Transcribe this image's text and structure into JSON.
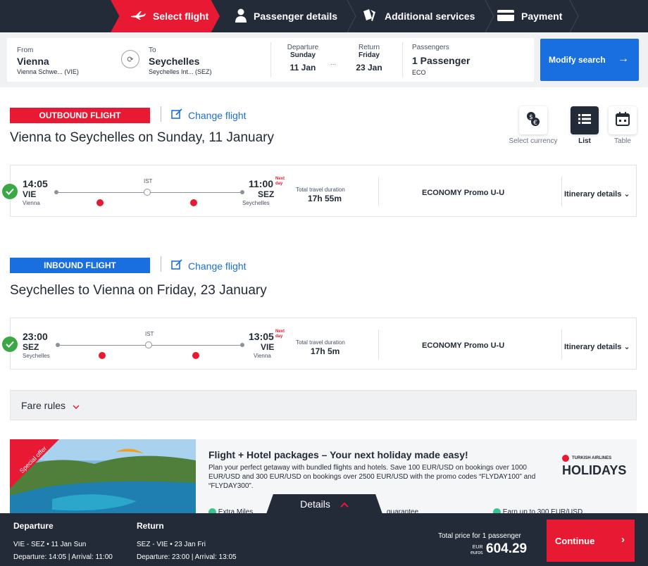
{
  "steps": [
    {
      "label": "Select flight",
      "icon": "plane-icon",
      "active": true
    },
    {
      "label": "Passenger details",
      "icon": "person-icon",
      "active": false
    },
    {
      "label": "Additional services",
      "icon": "services-icon",
      "active": false
    },
    {
      "label": "Payment",
      "icon": "card-icon",
      "active": false
    }
  ],
  "search": {
    "from_label": "From",
    "from_city": "Vienna",
    "from_airport": "Vienna Schwe... (VIE)",
    "to_label": "To",
    "to_city": "Seychelles",
    "to_airport": "Seychelles Int... (SEZ)",
    "departure_label": "Departure",
    "departure_day": "Sunday",
    "departure_date": "11 Jan",
    "range_dots": "...",
    "return_label": "Return",
    "return_day": "Friday",
    "return_date": "23 Jan",
    "passengers_label": "Passengers",
    "passengers_value": "1 Passenger",
    "cabin": "ECO",
    "modify_label": "Modify search"
  },
  "view": {
    "currency_label": "Select currency",
    "list_label": "List",
    "table_label": "Table"
  },
  "outbound": {
    "badge": "OUTBOUND FLIGHT",
    "change": "Change flight",
    "title": "Vienna to Seychelles on Sunday, 11 January",
    "dep_time": "14:05",
    "dep_code": "VIE",
    "dep_city": "Vienna",
    "arr_time": "11:00",
    "arr_code": "SEZ",
    "arr_city": "Seychelles",
    "next_day_1": "Next",
    "next_day_2": "day",
    "stop": "IST",
    "duration_label": "Total travel duration",
    "duration": "17h 55m",
    "fare": "ECONOMY Promo U-U",
    "itinerary": "Itinerary details"
  },
  "inbound": {
    "badge": "INBOUND FLIGHT",
    "change": "Change flight",
    "title": "Seychelles to Vienna on Friday, 23 January",
    "dep_time": "23:00",
    "dep_code": "SEZ",
    "dep_city": "Seychelles",
    "arr_time": "13:05",
    "arr_code": "VIE",
    "arr_city": "Vienna",
    "next_day_1": "Next",
    "next_day_2": "day",
    "stop": "IST",
    "duration_label": "Total travel duration",
    "duration": "17h 5m",
    "fare": "ECONOMY Promo U-U",
    "itinerary": "Itinerary details"
  },
  "fare_rules": "Fare rules",
  "promo": {
    "ribbon": "Special offer",
    "title": "Flight + Hotel packages – Your next holiday made easy!",
    "text": "Plan your perfect getaway with bundled flights and hotels. Save 100 EUR/USD on bookings over 1000 EUR/USD and 300 EUR/USD on bookings over 2500 EUR/USD with the promo codes “FLYDAY100” and “FLYDAY300”.",
    "brand_small": "TURKISH AIRLINES",
    "brand_big": "HOLIDAYS",
    "feature_1": "Extra Miles",
    "feature_2": "guarantee",
    "feature_3": "Earn up to 300 EUR/USD"
  },
  "bottom": {
    "details_label": "Details",
    "departure_h": "Departure",
    "departure_route": "VIE  -  SEZ  •  11 Jan Sun",
    "departure_times": "Departure: 14:05 | Arrival: 11:00",
    "return_h": "Return",
    "return_route": "SEZ  -  VIE  •  23 Jan Fri",
    "return_times": "Departure: 23:00 | Arrival: 13:05",
    "total_label": "Total price for 1 passenger",
    "currency_code": "EUR",
    "currency_word": "euros",
    "price": "604.29",
    "continue_label": "Continue"
  },
  "colors": {
    "brand_red": "#e81932",
    "brand_blue": "#1a6fe0",
    "dark": "#232b38",
    "success": "#3aa845"
  }
}
